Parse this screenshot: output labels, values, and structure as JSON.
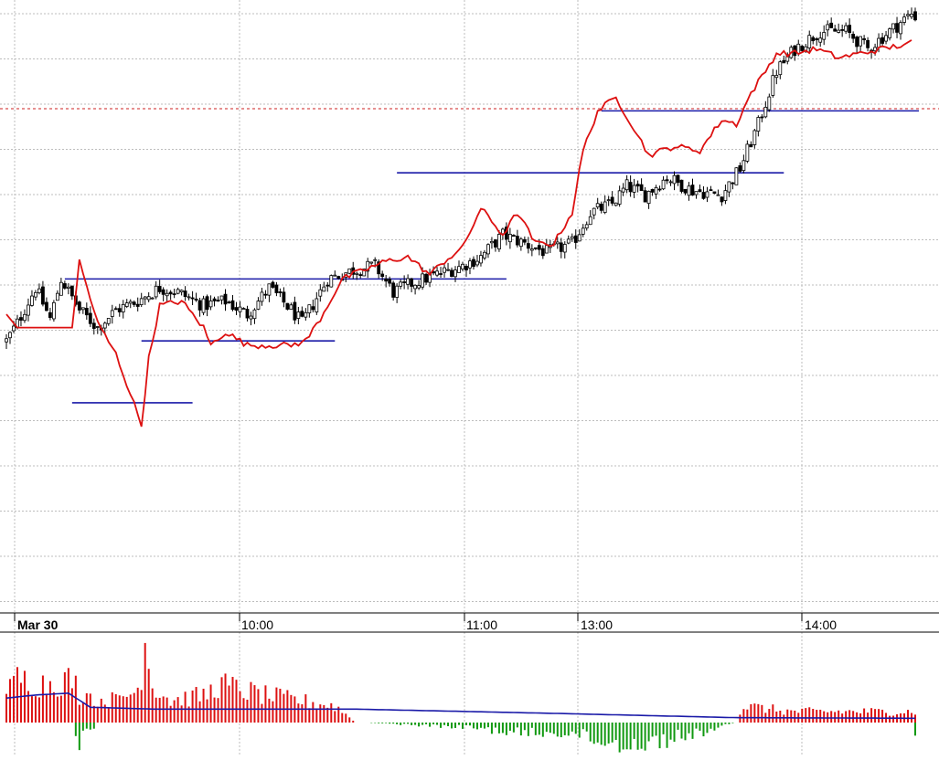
{
  "colors": {
    "background": "#ffffff",
    "grid": "#bdbdbd",
    "candle_outline": "#000000",
    "candle_down_fill": "#000000",
    "candle_up_fill": "#ffffff",
    "overlay_line": "#dd1111",
    "level_lines": "#1a1aa8",
    "reference_line": "#cc2222",
    "hist_positive": "#dd1111",
    "hist_negative": "#119911",
    "hist_average": "#1a1aa8",
    "axis": "#000000"
  },
  "x_axis": {
    "labels": [
      {
        "text": "Mar 30",
        "bar": 3,
        "bold": true
      },
      {
        "text": "10:00",
        "bar": 64,
        "bold": false
      },
      {
        "text": "11:00",
        "bar": 125,
        "bold": false
      },
      {
        "text": "13:00",
        "bar": 156,
        "bold": false
      },
      {
        "text": "14:00",
        "bar": 217,
        "bold": false
      }
    ]
  },
  "chart_data": [
    {
      "type": "candlestick",
      "title": "",
      "xlabel": "",
      "ylabel": "",
      "price_range": [
        0,
        100
      ],
      "grid": true,
      "bar_count": 250,
      "close_anchors": [
        [
          0,
          62
        ],
        [
          3,
          66
        ],
        [
          8,
          74
        ],
        [
          12,
          67
        ],
        [
          15,
          76
        ],
        [
          20,
          69
        ],
        [
          25,
          65
        ],
        [
          30,
          69
        ],
        [
          36,
          71
        ],
        [
          42,
          74
        ],
        [
          47,
          73
        ],
        [
          54,
          70
        ],
        [
          60,
          71
        ],
        [
          66,
          68
        ],
        [
          72,
          74
        ],
        [
          78,
          69
        ],
        [
          81,
          66
        ],
        [
          88,
          76
        ],
        [
          95,
          78
        ],
        [
          101,
          79
        ],
        [
          106,
          73
        ],
        [
          111,
          75
        ],
        [
          118,
          77
        ],
        [
          125,
          79
        ],
        [
          130,
          81
        ],
        [
          136,
          86
        ],
        [
          142,
          84
        ],
        [
          148,
          82
        ],
        [
          155,
          84
        ],
        [
          160,
          91
        ],
        [
          166,
          93
        ],
        [
          170,
          97
        ],
        [
          175,
          95
        ],
        [
          181,
          99
        ],
        [
          188,
          96
        ],
        [
          196,
          95
        ],
        [
          201,
          101
        ],
        [
          206,
          111
        ],
        [
          211,
          123
        ],
        [
          216,
          128
        ],
        [
          223,
          132
        ],
        [
          230,
          132
        ],
        [
          236,
          128
        ],
        [
          242,
          132
        ],
        [
          248,
          136
        ],
        [
          250,
          135
        ]
      ],
      "level_lines": [
        {
          "from_bar": 16,
          "to_bar": 137,
          "value": 76
        },
        {
          "from_bar": 37,
          "to_bar": 90,
          "value": 62
        },
        {
          "from_bar": 18,
          "to_bar": 51,
          "value": 48
        },
        {
          "from_bar": 107,
          "to_bar": 213,
          "value": 100
        },
        {
          "from_bar": 163,
          "to_bar": 250,
          "value": 114
        }
      ],
      "reference_line": {
        "value": 114.5,
        "style": "dashed"
      },
      "overlay_anchors": [
        [
          0,
          68
        ],
        [
          3,
          65
        ],
        [
          18,
          65
        ],
        [
          20,
          80
        ],
        [
          25,
          66
        ],
        [
          30,
          59
        ],
        [
          34,
          50
        ],
        [
          37,
          43
        ],
        [
          39,
          58
        ],
        [
          42,
          70
        ],
        [
          48,
          71
        ],
        [
          54,
          65
        ],
        [
          56,
          61
        ],
        [
          60,
          64
        ],
        [
          66,
          61
        ],
        [
          72,
          61
        ],
        [
          78,
          61
        ],
        [
          82,
          62
        ],
        [
          86,
          67
        ],
        [
          92,
          76
        ],
        [
          98,
          78
        ],
        [
          104,
          80
        ],
        [
          110,
          81
        ],
        [
          116,
          77
        ],
        [
          120,
          80
        ],
        [
          125,
          83
        ],
        [
          130,
          92
        ],
        [
          136,
          86
        ],
        [
          140,
          91
        ],
        [
          145,
          84
        ],
        [
          150,
          84
        ],
        [
          155,
          91
        ],
        [
          158,
          105
        ],
        [
          162,
          114
        ],
        [
          167,
          117
        ],
        [
          172,
          110
        ],
        [
          176,
          104
        ],
        [
          183,
          106
        ],
        [
          190,
          105
        ],
        [
          196,
          112
        ],
        [
          200,
          111
        ],
        [
          204,
          118
        ],
        [
          208,
          123
        ],
        [
          211,
          127
        ],
        [
          216,
          127
        ],
        [
          222,
          128
        ],
        [
          228,
          126
        ],
        [
          234,
          127
        ],
        [
          240,
          128
        ],
        [
          246,
          129
        ],
        [
          248,
          130
        ]
      ]
    },
    {
      "type": "histogram",
      "title": "",
      "bar_count": 250,
      "positive_value_anchors": [
        [
          0,
          5
        ],
        [
          3,
          8
        ],
        [
          10,
          7
        ],
        [
          18,
          8
        ],
        [
          20,
          5
        ],
        [
          30,
          4
        ],
        [
          36,
          6
        ],
        [
          38,
          13
        ],
        [
          40,
          7
        ],
        [
          45,
          4
        ],
        [
          55,
          5
        ],
        [
          58,
          7
        ],
        [
          70,
          5
        ],
        [
          80,
          4
        ],
        [
          90,
          3
        ],
        [
          96,
          0
        ],
        [
          118,
          0
        ],
        [
          120,
          0
        ],
        [
          200,
          0
        ],
        [
          202,
          3
        ],
        [
          215,
          2
        ],
        [
          248,
          2
        ]
      ],
      "negative_value_anchors": [
        [
          0,
          0
        ],
        [
          18,
          0
        ],
        [
          20,
          4
        ],
        [
          25,
          0
        ],
        [
          98,
          0
        ],
        [
          128,
          1
        ],
        [
          140,
          2
        ],
        [
          155,
          2
        ],
        [
          165,
          4
        ],
        [
          175,
          4
        ],
        [
          190,
          2
        ],
        [
          200,
          0
        ],
        [
          248,
          0
        ],
        [
          249,
          2
        ]
      ],
      "average_anchors": [
        [
          0,
          4
        ],
        [
          8,
          4.5
        ],
        [
          17,
          4.8
        ],
        [
          23,
          2.5
        ],
        [
          40,
          2.2
        ],
        [
          95,
          2.2
        ],
        [
          150,
          1.5
        ],
        [
          200,
          0.8
        ],
        [
          250,
          0.7
        ]
      ],
      "zero_line": 0
    }
  ]
}
